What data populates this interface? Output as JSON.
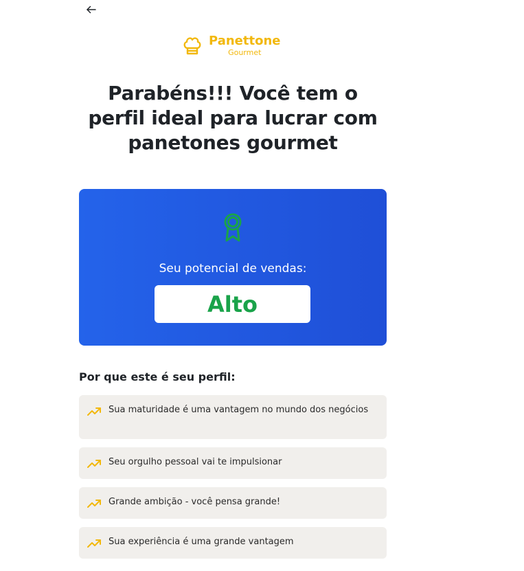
{
  "nav": {
    "back_icon": "arrow-left-icon"
  },
  "brand": {
    "name": "Panettone",
    "subtitle": "Gourmet",
    "icon": "chef-hat-icon",
    "color": "#f2b80c"
  },
  "headline": "Parabéns!!! Você tem o perfil ideal para lucrar com panetones gourmet",
  "result_card": {
    "icon": "award-icon",
    "label": "Seu potencial de vendas:",
    "value": "Alto",
    "value_color": "#1aa34a",
    "background": "#2463ea"
  },
  "reasons": {
    "title": "Por que este é seu perfil:",
    "icon": "trending-up-icon",
    "items": [
      {
        "text": "Sua maturidade é uma vantagem no mundo dos negócios"
      },
      {
        "text": "Seu orgulho pessoal vai te impulsionar"
      },
      {
        "text": "Grande ambição - você pensa grande!"
      },
      {
        "text": "Sua experiência é uma grande vantagem"
      }
    ]
  }
}
